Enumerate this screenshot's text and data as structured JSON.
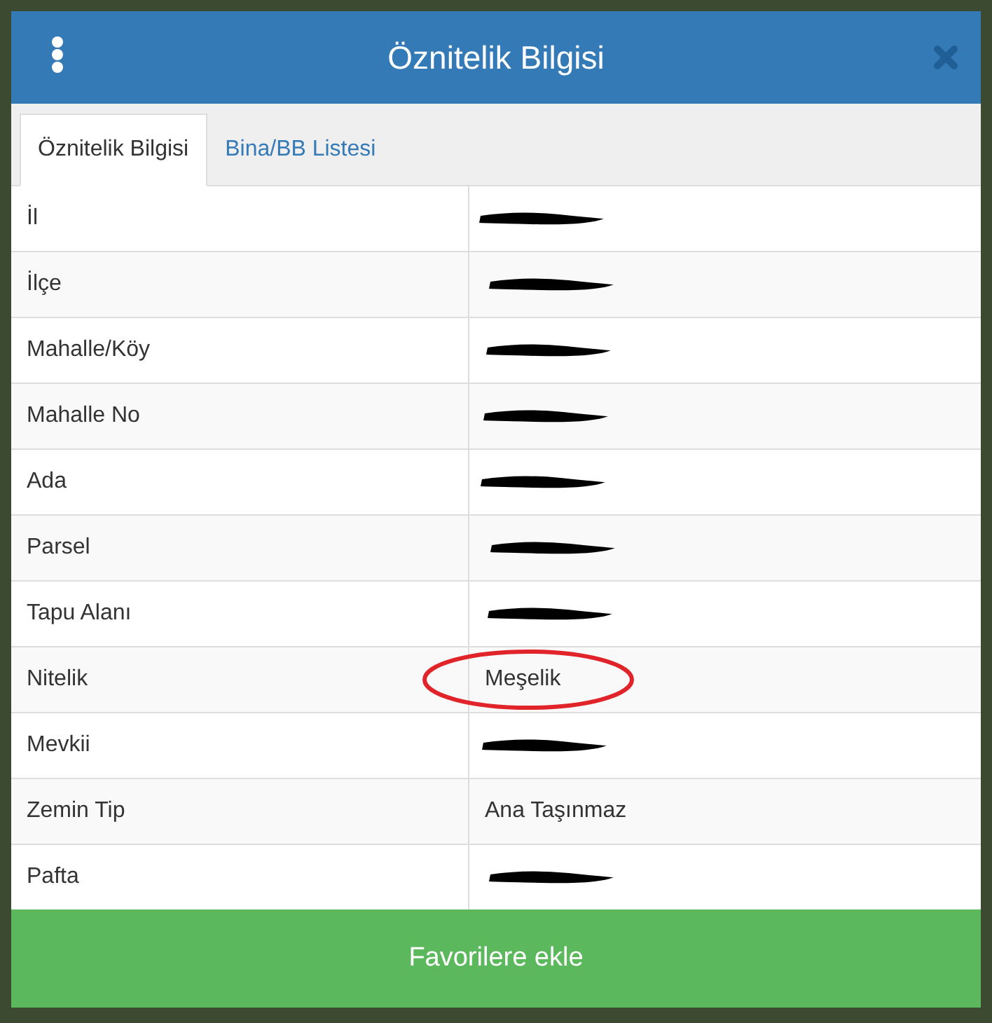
{
  "dialog": {
    "title": "Öznitelik Bilgisi"
  },
  "tabs": [
    {
      "label": "Öznitelik Bilgisi",
      "selected": true
    },
    {
      "label": "Bina/BB Listesi",
      "selected": false
    }
  ],
  "rows": [
    {
      "label": "İl",
      "redacted": true
    },
    {
      "label": "İlçe",
      "redacted": true
    },
    {
      "label": "Mahalle/Köy",
      "redacted": true
    },
    {
      "label": "Mahalle No",
      "redacted": true
    },
    {
      "label": "Ada",
      "redacted": true
    },
    {
      "label": "Parsel",
      "redacted": true
    },
    {
      "label": "Tapu Alanı",
      "redacted": true
    },
    {
      "label": "Nitelik",
      "value": "Meşelik",
      "redacted": false,
      "circled": true
    },
    {
      "label": "Mevkii",
      "redacted": true
    },
    {
      "label": "Zemin Tip",
      "value": "Ana Taşınmaz",
      "redacted": false
    },
    {
      "label": "Pafta",
      "redacted": true
    }
  ],
  "button": "Favorilere ekle"
}
